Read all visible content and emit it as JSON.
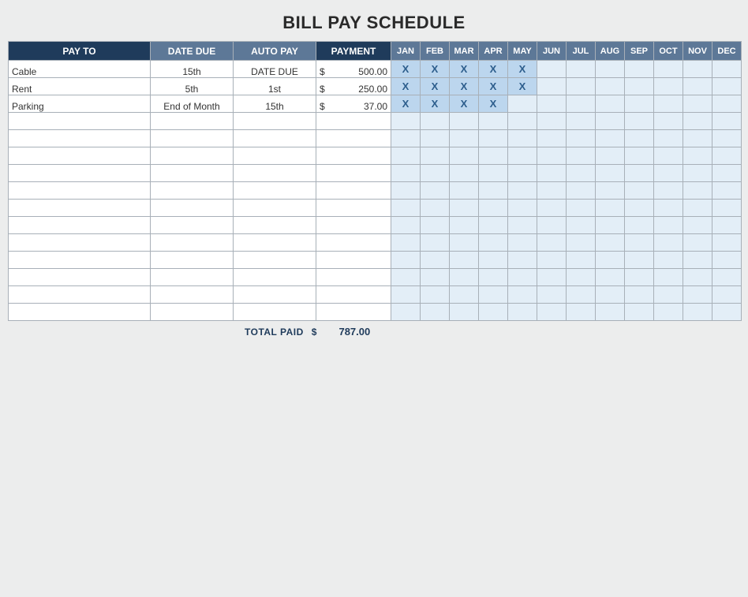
{
  "title": "BILL PAY SCHEDULE",
  "headers": {
    "payto": "PAY TO",
    "due": "DATE DUE",
    "auto": "AUTO PAY",
    "payment": "PAYMENT",
    "months": [
      "JAN",
      "FEB",
      "MAR",
      "APR",
      "MAY",
      "JUN",
      "JUL",
      "AUG",
      "SEP",
      "OCT",
      "NOV",
      "DEC"
    ]
  },
  "currency": "$",
  "mark": "X",
  "rows": [
    {
      "payto": "Cable",
      "due": "15th",
      "auto": "DATE DUE",
      "payment": "500.00",
      "months": [
        true,
        true,
        true,
        true,
        true,
        false,
        false,
        false,
        false,
        false,
        false,
        false
      ]
    },
    {
      "payto": "Rent",
      "due": "5th",
      "auto": "1st",
      "payment": "250.00",
      "months": [
        true,
        true,
        true,
        true,
        true,
        false,
        false,
        false,
        false,
        false,
        false,
        false
      ]
    },
    {
      "payto": "Parking",
      "due": "End of Month",
      "auto": "15th",
      "payment": "37.00",
      "months": [
        true,
        true,
        true,
        true,
        false,
        false,
        false,
        false,
        false,
        false,
        false,
        false
      ]
    },
    {
      "payto": "",
      "due": "",
      "auto": "",
      "payment": "",
      "months": [
        false,
        false,
        false,
        false,
        false,
        false,
        false,
        false,
        false,
        false,
        false,
        false
      ]
    },
    {
      "payto": "",
      "due": "",
      "auto": "",
      "payment": "",
      "months": [
        false,
        false,
        false,
        false,
        false,
        false,
        false,
        false,
        false,
        false,
        false,
        false
      ]
    },
    {
      "payto": "",
      "due": "",
      "auto": "",
      "payment": "",
      "months": [
        false,
        false,
        false,
        false,
        false,
        false,
        false,
        false,
        false,
        false,
        false,
        false
      ]
    },
    {
      "payto": "",
      "due": "",
      "auto": "",
      "payment": "",
      "months": [
        false,
        false,
        false,
        false,
        false,
        false,
        false,
        false,
        false,
        false,
        false,
        false
      ]
    },
    {
      "payto": "",
      "due": "",
      "auto": "",
      "payment": "",
      "months": [
        false,
        false,
        false,
        false,
        false,
        false,
        false,
        false,
        false,
        false,
        false,
        false
      ]
    },
    {
      "payto": "",
      "due": "",
      "auto": "",
      "payment": "",
      "months": [
        false,
        false,
        false,
        false,
        false,
        false,
        false,
        false,
        false,
        false,
        false,
        false
      ]
    },
    {
      "payto": "",
      "due": "",
      "auto": "",
      "payment": "",
      "months": [
        false,
        false,
        false,
        false,
        false,
        false,
        false,
        false,
        false,
        false,
        false,
        false
      ]
    },
    {
      "payto": "",
      "due": "",
      "auto": "",
      "payment": "",
      "months": [
        false,
        false,
        false,
        false,
        false,
        false,
        false,
        false,
        false,
        false,
        false,
        false
      ]
    },
    {
      "payto": "",
      "due": "",
      "auto": "",
      "payment": "",
      "months": [
        false,
        false,
        false,
        false,
        false,
        false,
        false,
        false,
        false,
        false,
        false,
        false
      ]
    },
    {
      "payto": "",
      "due": "",
      "auto": "",
      "payment": "",
      "months": [
        false,
        false,
        false,
        false,
        false,
        false,
        false,
        false,
        false,
        false,
        false,
        false
      ]
    },
    {
      "payto": "",
      "due": "",
      "auto": "",
      "payment": "",
      "months": [
        false,
        false,
        false,
        false,
        false,
        false,
        false,
        false,
        false,
        false,
        false,
        false
      ]
    },
    {
      "payto": "",
      "due": "",
      "auto": "",
      "payment": "",
      "months": [
        false,
        false,
        false,
        false,
        false,
        false,
        false,
        false,
        false,
        false,
        false,
        false
      ]
    }
  ],
  "footer": {
    "label": "TOTAL PAID",
    "symbol": "$",
    "value": "787.00"
  }
}
